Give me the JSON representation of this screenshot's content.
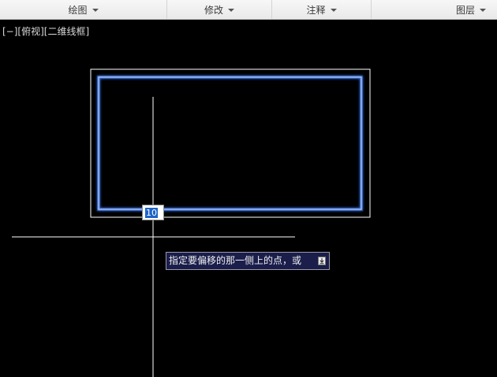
{
  "ribbon": {
    "panels": [
      {
        "label": "绘图"
      },
      {
        "label": "修改"
      },
      {
        "label": "注释"
      },
      {
        "label": "图层"
      }
    ]
  },
  "viewport": {
    "control": "[−]",
    "view": "[俯视]",
    "style": "[二维线框]"
  },
  "dynamic_input": {
    "value": "10"
  },
  "command_prompt": {
    "text": "指定要偏移的那一侧上的点，或",
    "options_icon": "down-arrow-icon"
  },
  "colors": {
    "background": "#000000",
    "selected_rect": "#5b8fe8",
    "geometry": "#ffffff",
    "prompt_bg": "#1b1e4b",
    "input_highlight": "#1e63c9"
  }
}
